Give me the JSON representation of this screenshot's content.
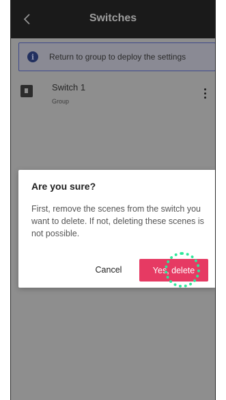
{
  "header": {
    "title": "Switches",
    "back_icon": "chevron-left-icon"
  },
  "banner": {
    "icon": "info-icon",
    "icon_glyph": "i",
    "text": "Return to group to deploy the settings"
  },
  "switch_list": [
    {
      "name": "Switch 1",
      "subtitle": "Group",
      "icon": "switch-device-icon",
      "menu_icon": "more-vertical-icon"
    }
  ],
  "dialog": {
    "title": "Are you sure?",
    "body": "First, remove the scenes from the switch you want to delete. If not, deleting these scenes is not possible.",
    "cancel_label": "Cancel",
    "confirm_label": "Yes, delete"
  },
  "colors": {
    "confirm_button": "#e63a63",
    "tap_indicator": "#2ee89a",
    "overlay": "#8e8e8e",
    "topbar": "#1a1a1a"
  }
}
